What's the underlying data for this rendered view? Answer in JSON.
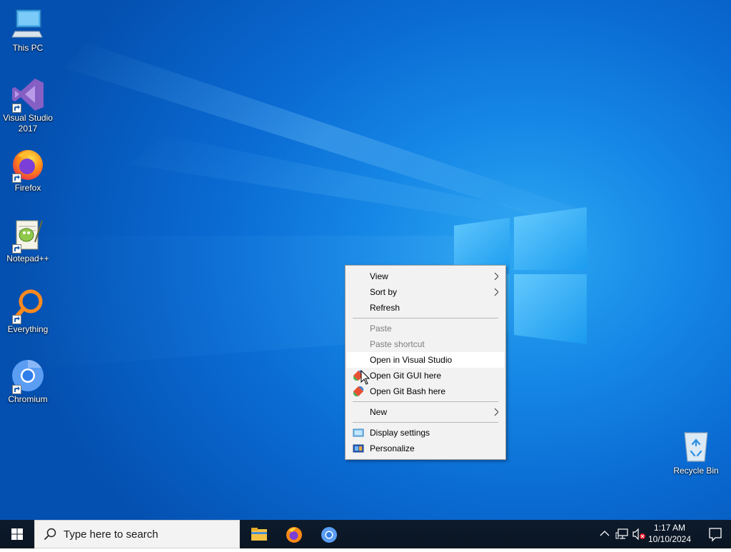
{
  "desktop": {
    "icons": [
      {
        "label_1": "This PC",
        "label_2": ""
      },
      {
        "label_1": "Visual Studio",
        "label_2": "2017"
      },
      {
        "label_1": "Firefox",
        "label_2": ""
      },
      {
        "label_1": "Notepad++",
        "label_2": ""
      },
      {
        "label_1": "Everything",
        "label_2": ""
      },
      {
        "label_1": "Chromium",
        "label_2": ""
      },
      {
        "label_1": "Recycle Bin",
        "label_2": ""
      }
    ]
  },
  "context_menu": {
    "items": [
      {
        "label": "View",
        "submenu": true,
        "disabled": false
      },
      {
        "label": "Sort by",
        "submenu": true,
        "disabled": false
      },
      {
        "label": "Refresh",
        "submenu": false,
        "disabled": false
      },
      {
        "label": "Paste",
        "submenu": false,
        "disabled": true
      },
      {
        "label": "Paste shortcut",
        "submenu": false,
        "disabled": true
      },
      {
        "label": "Open in Visual Studio",
        "submenu": false,
        "disabled": false,
        "highlighted": true
      },
      {
        "label": "Open Git GUI here",
        "submenu": false,
        "disabled": false,
        "icon": "git-gui-icon"
      },
      {
        "label": "Open Git Bash here",
        "submenu": false,
        "disabled": false,
        "icon": "git-bash-icon"
      },
      {
        "label": "New",
        "submenu": true,
        "disabled": false
      },
      {
        "label": "Display settings",
        "submenu": false,
        "disabled": false,
        "icon": "display-settings-icon"
      },
      {
        "label": "Personalize",
        "submenu": false,
        "disabled": false,
        "icon": "personalize-icon"
      }
    ]
  },
  "taskbar": {
    "search_placeholder": "Type here to search",
    "pinned_apps": [
      "file-explorer-icon",
      "firefox-icon",
      "chromium-icon"
    ],
    "clock_time": "1:17 AM",
    "clock_date": "10/10/2024"
  },
  "colors": {
    "desktop_blue": "#0a6bd3",
    "taskbar": "#0b1a2e",
    "menu_background": "#f2f2f2"
  }
}
